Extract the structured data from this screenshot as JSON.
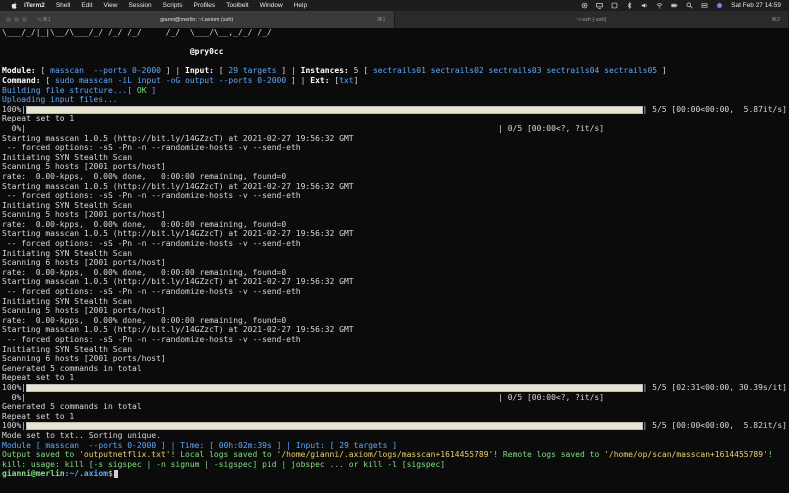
{
  "menubar": {
    "app": "iTerm2",
    "items": [
      "Shell",
      "Edit",
      "View",
      "Session",
      "Scripts",
      "Profiles",
      "Toolbelt",
      "Window",
      "Help"
    ],
    "clock": "Sat Feb 27  14:59",
    "status_icons": [
      "record-icon",
      "display-icon",
      "spotlight-icon",
      "bluetooth-icon",
      "volume-icon",
      "wifi-icon",
      "battery-icon",
      "search-icon",
      "control-center-icon",
      "siri-icon"
    ]
  },
  "tabs": [
    {
      "title": "gianni@merlin: ~/.axiom (ssh)",
      "left_shortcut": "⌥⌘1",
      "right_shortcut": "⌘1",
      "active": true
    },
    {
      "title": "~/.ssh (-zsh)",
      "right_shortcut": "⌘2",
      "active": false
    }
  ],
  "terminal": {
    "banner_line": "\\___/_/|_|\\__/\\___/_/ /_/ /_/     /_/  \\___/\\__,_/_/ /_/",
    "author": "                                       @pry0cc",
    "module_line": {
      "module_label": "Module:",
      "module_value": "masscan  --ports 0-2000",
      "input_label": "Input:",
      "input_value": "29 targets",
      "instances_label": "Instances:",
      "instances_count": "5",
      "instances_list": "sectrails01 sectrails02 sectrails03 sectrails04 sectrails05"
    },
    "command_line": {
      "command_label": "Command:",
      "command_value": "sudo masscan -iL input -oG output --ports 0-2000",
      "ext_label": "Ext:",
      "ext_value": "txt"
    },
    "building": "Building file structure...",
    "ok": "OK",
    "uploading": "Uploading input files...",
    "bar1": {
      "pct": "100%|",
      "right": "| 5/5 [00:00<00:00,  5.87it/s]",
      "fill": 1.0
    },
    "lines_a": [
      "Repeat set to 1",
      "  0%|                                                                                                  | 0/5 [00:00<?, ?it/s]",
      "Starting masscan 1.0.5 (http://bit.ly/14GZzcT) at 2021-02-27 19:56:32 GMT",
      " -- forced options: -sS -Pn -n --randomize-hosts -v --send-eth",
      "Initiating SYN Stealth Scan",
      "Scanning 5 hosts [2001 ports/host]",
      "rate:  0.00-kpps,  0.00% done,   0:00:00 remaining, found=0",
      "Starting masscan 1.0.5 (http://bit.ly/14GZzcT) at 2021-02-27 19:56:32 GMT",
      " -- forced options: -sS -Pn -n --randomize-hosts -v --send-eth",
      "Initiating SYN Stealth Scan",
      "Scanning 5 hosts [2001 ports/host]",
      "rate:  0.00-kpps,  0.00% done,   0:00:00 remaining, found=0",
      "Starting masscan 1.0.5 (http://bit.ly/14GZzcT) at 2021-02-27 19:56:32 GMT",
      " -- forced options: -sS -Pn -n --randomize-hosts -v --send-eth",
      "Initiating SYN Stealth Scan",
      "Scanning 6 hosts [2001 ports/host]",
      "rate:  0.00-kpps,  0.00% done,   0:00:00 remaining, found=0",
      "Starting masscan 1.0.5 (http://bit.ly/14GZzcT) at 2021-02-27 19:56:32 GMT",
      " -- forced options: -sS -Pn -n --randomize-hosts -v --send-eth",
      "Initiating SYN Stealth Scan",
      "Scanning 5 hosts [2001 ports/host]",
      "rate:  0.00-kpps,  0.00% done,   0:00:00 remaining, found=0",
      "Starting masscan 1.0.5 (http://bit.ly/14GZzcT) at 2021-02-27 19:56:32 GMT",
      " -- forced options: -sS -Pn -n --randomize-hosts -v --send-eth",
      "Initiating SYN Stealth Scan",
      "Scanning 6 hosts [2001 ports/host]",
      "Generated 5 commands in total",
      "Repeat set to 1"
    ],
    "bar2": {
      "pct": "100%|",
      "right": "| 5/5 [02:31<00:00, 30.39s/it]",
      "fill": 1.0
    },
    "lines_b": [
      "  0%|                                                                                                  | 0/5 [00:00<?, ?it/s]",
      "Generated 5 commands in total",
      "Repeat set to 1"
    ],
    "bar3": {
      "pct": "100%|",
      "right": "| 5/5 [00:00<00:00,  5.82it/s]",
      "fill": 1.0
    },
    "mode_line": "Mode set to txt.. Sorting unique.",
    "summary": {
      "module_label": "Module",
      "module_value": "masscan  --ports 0-2000",
      "time_label": "Time:",
      "time_value": "00h:02m:39s",
      "input_label": "Input:",
      "input_value": "29 targets"
    },
    "output_line": {
      "p1": "Output saved to ",
      "file": "'outputnetflix.txt'",
      "p2": "! Local logs saved to ",
      "local": "'/home/gianni/.axiom/logs/masscan+1614455789'",
      "p3": "! Remote logs saved to ",
      "remote": "'/home/op/scan/masscan+1614455789'",
      "p4": "!"
    },
    "kill_line": "kill: usage: kill [-s sigspec | -n signum | -sigspec] pid | jobspec ... or kill -l [sigspec]",
    "prompt_user": "gianni@merlin",
    "prompt_path": ":~/.axiom",
    "prompt_sign": "$"
  }
}
